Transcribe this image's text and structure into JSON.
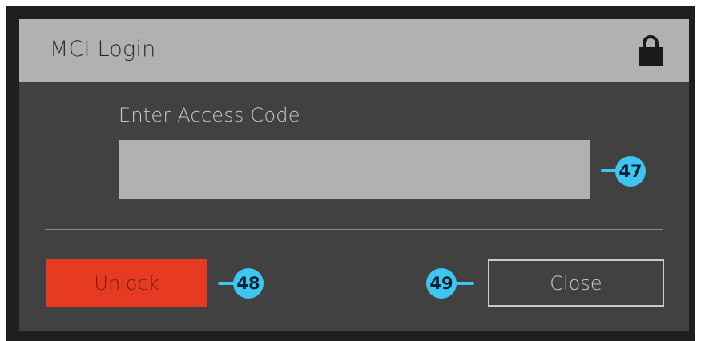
{
  "dialog": {
    "title": "MCI Login",
    "lock_icon": "lock-icon",
    "access_label": "Enter Access Code",
    "access_input": {
      "value": "",
      "placeholder": ""
    },
    "unlock_label": "Unlock",
    "close_label": "Close"
  },
  "callouts": {
    "input": "47",
    "unlock": "48",
    "close": "49"
  },
  "colors": {
    "titlebar": "#b1b1b1",
    "dialog_bg": "#414141",
    "unlock_bg": "#e63a22",
    "callout": "#3ec6f0"
  }
}
